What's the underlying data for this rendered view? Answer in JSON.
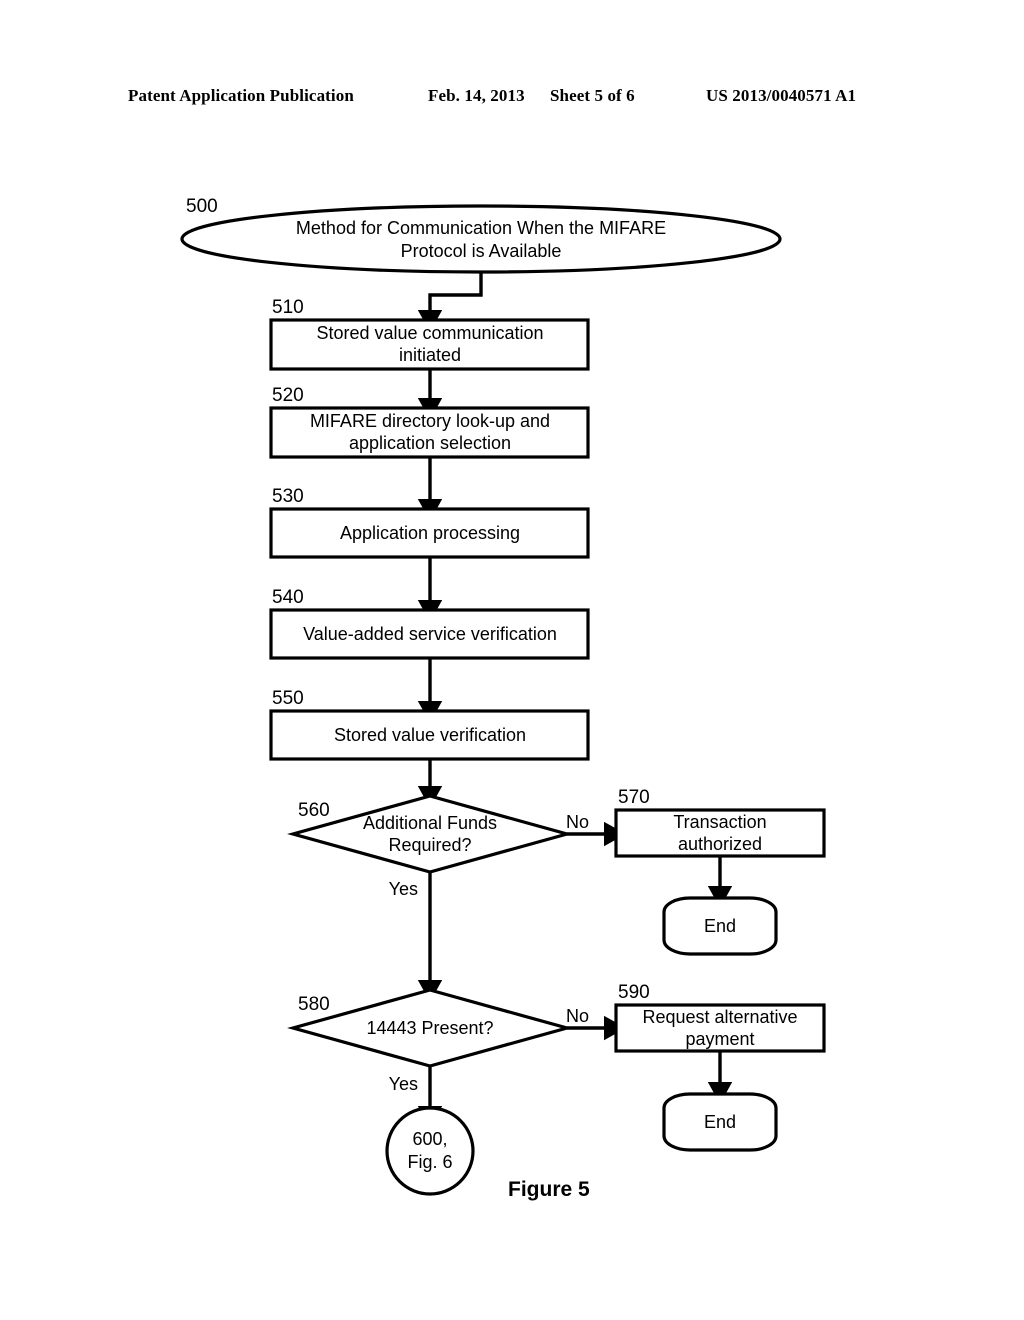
{
  "header": {
    "left": "Patent Application Publication",
    "date": "Feb. 14, 2013",
    "sheet": "Sheet 5 of 6",
    "publication_number": "US 2013/0040571 A1"
  },
  "figure": {
    "caption": "Figure 5"
  },
  "diagram": {
    "type": "flowchart",
    "start": {
      "ref": "500",
      "shape": "oval",
      "line1": "Method for Communication When the MIFARE",
      "line2": "Protocol is Available"
    },
    "steps": [
      {
        "ref": "510",
        "shape": "process",
        "line1": "Stored value communication",
        "line2": "initiated"
      },
      {
        "ref": "520",
        "shape": "process",
        "line1": "MIFARE directory look-up and",
        "line2": "application selection"
      },
      {
        "ref": "530",
        "shape": "process",
        "line1": "Application processing",
        "line2": ""
      },
      {
        "ref": "540",
        "shape": "process",
        "line1": "Value-added service verification",
        "line2": ""
      },
      {
        "ref": "550",
        "shape": "process",
        "line1": "Stored value verification",
        "line2": ""
      }
    ],
    "decisions": [
      {
        "ref": "560",
        "shape": "diamond",
        "line1": "Additional Funds",
        "line2": "Required?",
        "yes_label": "Yes",
        "no_label": "No"
      },
      {
        "ref": "580",
        "shape": "diamond",
        "line1": "14443 Present?",
        "line2": "",
        "yes_label": "Yes",
        "no_label": "No"
      }
    ],
    "outcomes": [
      {
        "ref": "570",
        "shape": "process",
        "line1": "Transaction",
        "line2": "authorized"
      },
      {
        "ref": "590",
        "shape": "process",
        "line1": "Request alternative",
        "line2": "payment"
      }
    ],
    "terminators": [
      {
        "shape": "rounded",
        "label": "End"
      },
      {
        "shape": "rounded",
        "label": "End"
      }
    ],
    "connector": {
      "shape": "circle",
      "line1": "600,",
      "line2": "Fig. 6"
    }
  }
}
